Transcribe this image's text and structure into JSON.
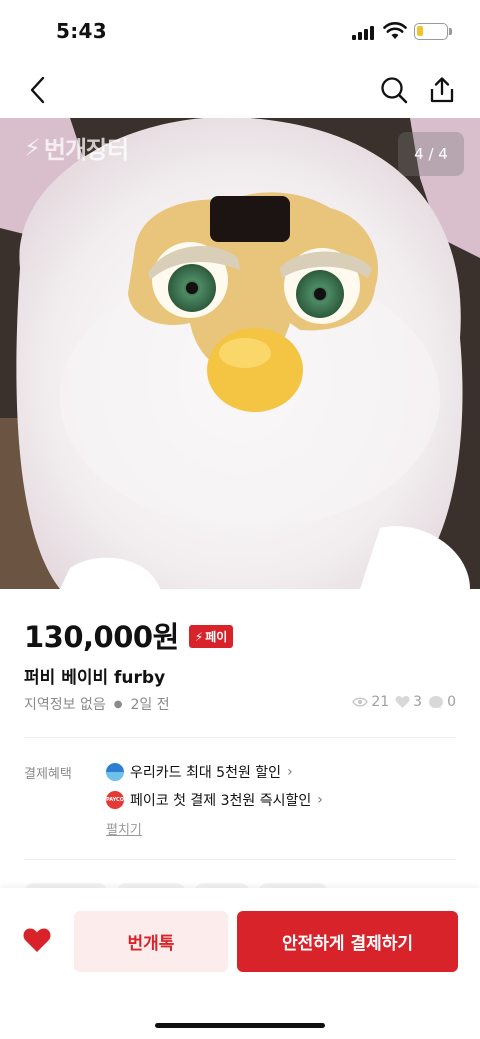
{
  "status_bar": {
    "time": "5:43"
  },
  "hero": {
    "watermark": "번개장터",
    "counter": "4 / 4"
  },
  "product": {
    "price": "130,000원",
    "pay_badge": "페이",
    "title": "퍼비 베이비 furby",
    "location": "지역정보 없음",
    "posted": "2일 전",
    "views": "21",
    "likes": "3",
    "chats": "0"
  },
  "benefits": {
    "label": "결제혜택",
    "items": [
      {
        "text": "우리카드 최대 5천원 할인",
        "icon": "woori-card-icon"
      },
      {
        "text": "페이코 첫 결제 3천원 즉시할인",
        "icon": "payco-icon"
      }
    ],
    "expand": "펼치기"
  },
  "bottom_bar": {
    "chat_label": "번개톡",
    "pay_label": "안전하게 결제하기"
  },
  "colors": {
    "accent": "#d8232a",
    "accent_soft": "#fdecec"
  }
}
